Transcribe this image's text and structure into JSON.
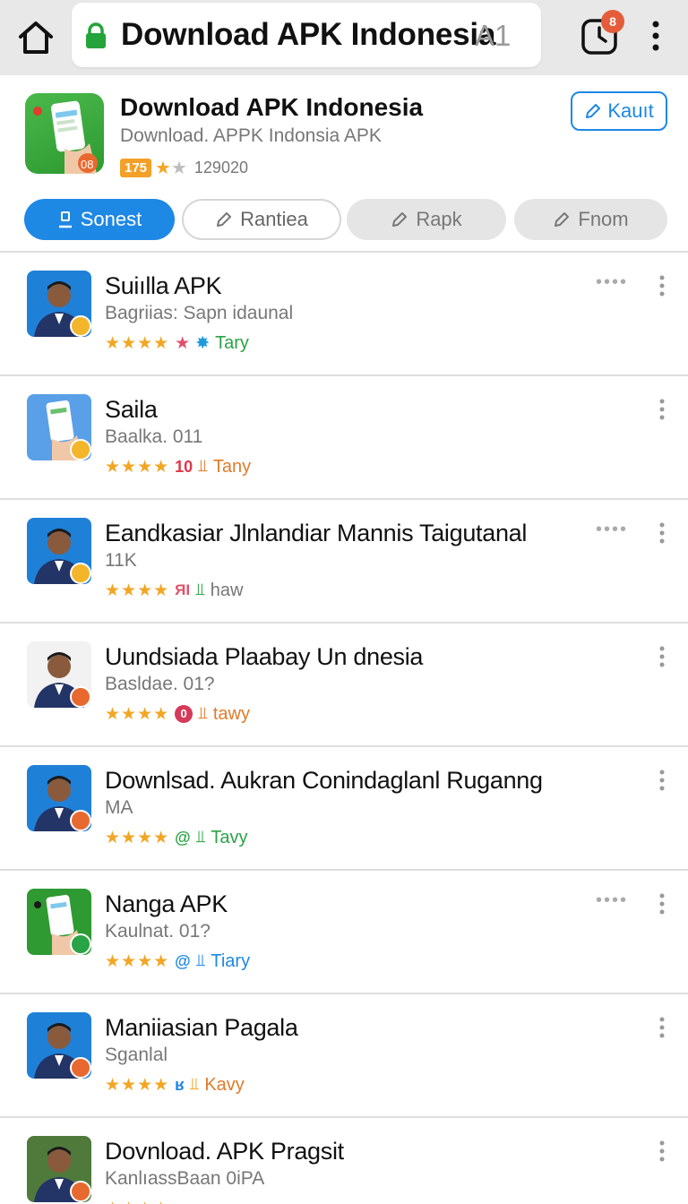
{
  "browser": {
    "url_text": "Download APK Indonesia",
    "url_suffix": "A1",
    "tab_badge": "8"
  },
  "app": {
    "title": "Download APK Indonesia",
    "subtitle": "Download. APPK Indonsia APK",
    "rating_box": "175",
    "stars_display": "★★",
    "downloads": "129020",
    "install_label": "Kauıt"
  },
  "chips": [
    {
      "label": "Sonest"
    },
    {
      "label": "Rantiea"
    },
    {
      "label": "Rapk"
    },
    {
      "label": "Fnom"
    }
  ],
  "items": [
    {
      "title": "Suiılla APK",
      "subtitle": "Bagriias: Sapn idaunal",
      "stars": "★★★★",
      "meta_extra": "★",
      "meta_label": "Tary",
      "label_color": "#2aa345",
      "thumb": "person",
      "badge_color": "#f3b62b",
      "show_more": true
    },
    {
      "title": "Saila",
      "subtitle": "Baalka. 011",
      "stars": "★★★★",
      "meta_extra": "10",
      "meta_label": "Tany",
      "label_color": "#e07b2a",
      "thumb": "phone",
      "badge_color": "#f3b62b",
      "show_more": false
    },
    {
      "title": "Eandkasiar Jlnlandiar Mannis Taigutanal",
      "subtitle": "11K",
      "stars": "★★★★",
      "meta_extra": "ЯΙ",
      "meta_label": "haw",
      "label_color": "#777777",
      "thumb": "person",
      "badge_color": "#f3b62b",
      "show_more": true
    },
    {
      "title": "Uundsiada Plaabay Un dnesia",
      "subtitle": "Basldae. 01?",
      "stars": "★★★★",
      "meta_extra": "0",
      "meta_label": "tawy",
      "label_color": "#e07b2a",
      "thumb": "person",
      "badge_color": "#e8692f",
      "show_more": false
    },
    {
      "title": "Downlsad. Aukran Conindaglanl Ruganng",
      "subtitle": "MA",
      "stars": "★★★★",
      "meta_extra": "@",
      "meta_label": "Tavy",
      "label_color": "#2aa345",
      "thumb": "person",
      "badge_color": "#e8692f",
      "show_more": false
    },
    {
      "title": "Nanga APK",
      "subtitle": "Kaulnat. 01?",
      "stars": "★★★★",
      "meta_extra": "@",
      "meta_label": "Tiary",
      "label_color": "#1e88e5",
      "thumb": "green",
      "badge_color": "#2aa345",
      "show_more": true
    },
    {
      "title": "Maniiasian Pagala",
      "subtitle": "Sganlal",
      "stars": "★★★★",
      "meta_extra": "ʁ",
      "meta_label": "Kavy",
      "label_color": "#e07b2a",
      "thumb": "person",
      "badge_color": "#e8692f",
      "show_more": false
    },
    {
      "title": "Dovnload. APK Pragsit",
      "subtitle": "KanlıassBaan 0iPA",
      "stars": "★★★★",
      "meta_extra": "",
      "meta_label": "",
      "label_color": "#777777",
      "thumb": "person-photo",
      "badge_color": "#e8692f",
      "show_more": false
    }
  ],
  "colors": {
    "accent": "#1e88e5",
    "star": "#f2a623",
    "chrome_bg": "#e8e8e8"
  }
}
